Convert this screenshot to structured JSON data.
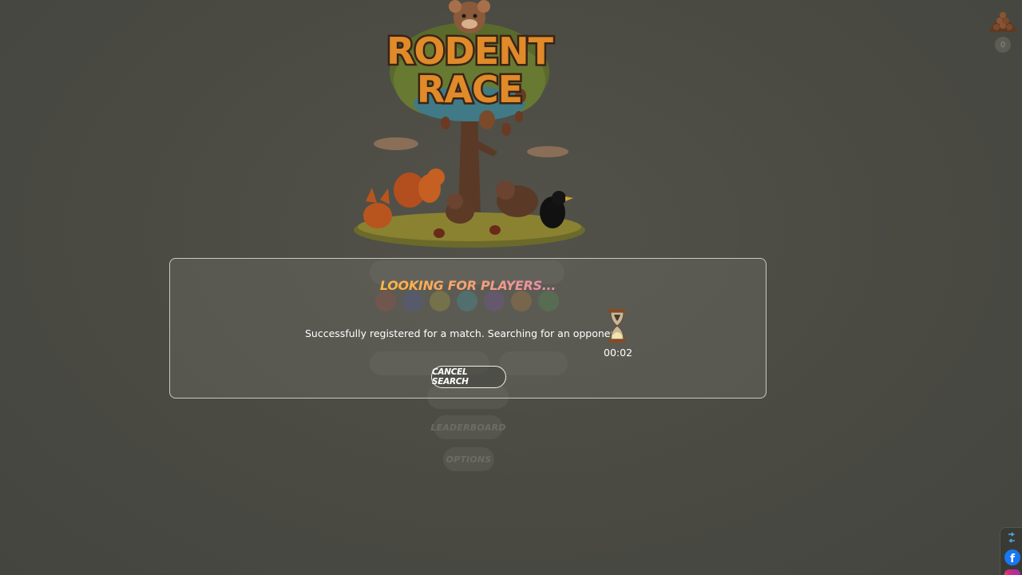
{
  "game": {
    "logo_line1": "RODENT",
    "logo_line2": "RACE"
  },
  "background_menu": {
    "color_dots": [
      "#c0392b",
      "#3b4cc0",
      "#d4c219",
      "#1fb5c9",
      "#7b3fc4",
      "#e08a1e",
      "#3aa845"
    ],
    "leaderboard_label": "LEADERBOARD",
    "options_label": "OPTIONS"
  },
  "currency": {
    "icon": "acorn-pile-icon",
    "count": "0"
  },
  "modal": {
    "title": "LOOKING FOR PLAYERS...",
    "message": "Successfully registered for a match. Searching for an opponent.",
    "timer": "00:02",
    "cancel_label": "CANCEL SEARCH"
  },
  "social": {
    "icons": [
      "share-icon",
      "facebook-icon",
      "instagram-icon"
    ],
    "facebook_glyph": "f"
  }
}
